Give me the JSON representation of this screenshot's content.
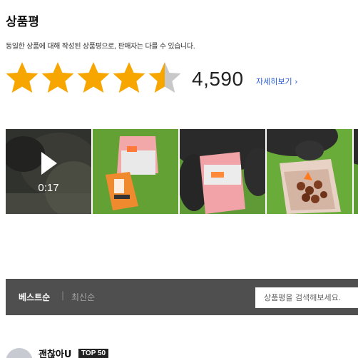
{
  "review": {
    "title": "상품평",
    "description": "동일한 상품에 대해 작성된 상품평으로, 판매자는 다를 수 있습니다.",
    "rating": 4.5,
    "rating_max": 5,
    "star_color": "#f7a600",
    "star_empty_color": "#c8c8c8",
    "count": "4,590",
    "detail_link": "자세히보기",
    "detail_link_color": "#2a5bd7"
  },
  "gallery": {
    "video_duration": "0:17",
    "items": [
      {
        "kind": "video",
        "icon": "play-icon"
      },
      {
        "kind": "photo"
      },
      {
        "kind": "photo"
      },
      {
        "kind": "photo"
      },
      {
        "kind": "photo"
      }
    ]
  },
  "filters": {
    "sort_best": "베스트순",
    "separator": "|",
    "sort_latest": "최신순",
    "search_placeholder": "상품평을 검색해보세요."
  },
  "reviewer": {
    "name": "괜찮아U",
    "badge": "TOP 50"
  }
}
